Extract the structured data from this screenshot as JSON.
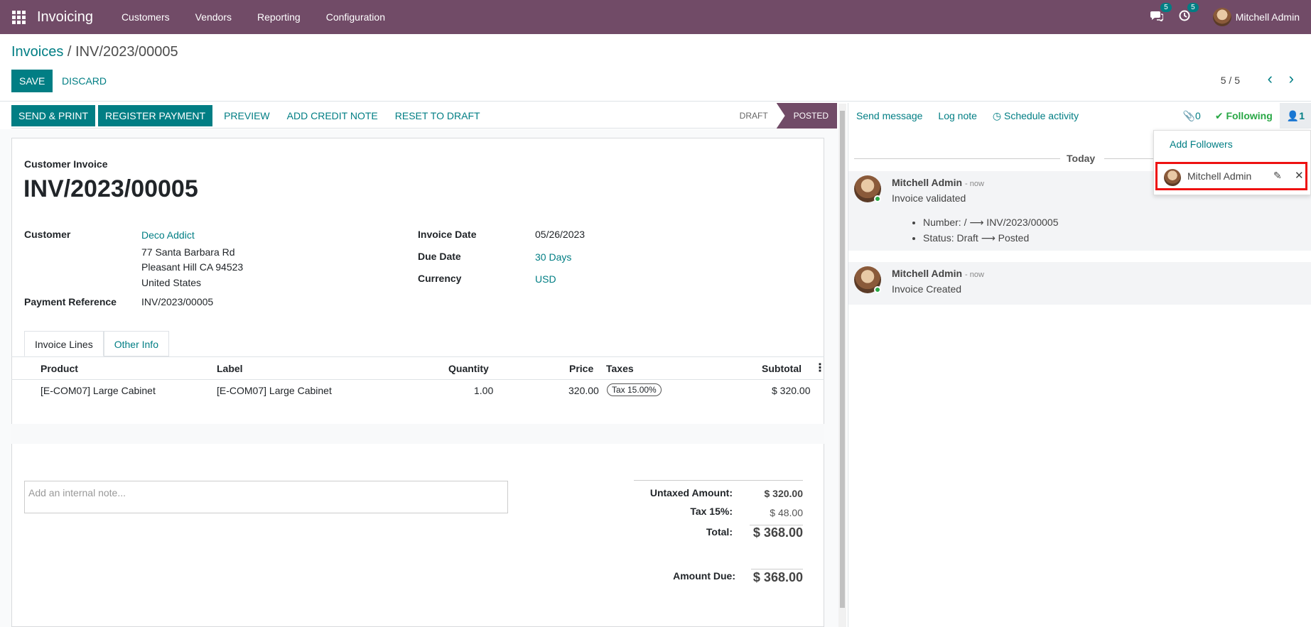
{
  "navbar": {
    "app_name": "Invoicing",
    "menu": [
      "Customers",
      "Vendors",
      "Reporting",
      "Configuration"
    ],
    "messages_badge": "5",
    "activities_badge": "5",
    "user_name": "Mitchell Admin",
    "bg_color": "#714b67"
  },
  "control_panel": {
    "breadcrumb_parent": "Invoices",
    "breadcrumb_sep": " / ",
    "breadcrumb_current": "INV/2023/00005",
    "save_label": "SAVE",
    "discard_label": "DISCARD",
    "pager": "5 / 5"
  },
  "statusbar": {
    "buttons_primary": [
      "SEND & PRINT",
      "REGISTER PAYMENT"
    ],
    "buttons_link": [
      "PREVIEW",
      "ADD CREDIT NOTE",
      "RESET TO DRAFT"
    ],
    "states": [
      "DRAFT",
      "POSTED"
    ],
    "active_state": "POSTED"
  },
  "invoice": {
    "type_label": "Customer Invoice",
    "number": "INV/2023/00005",
    "customer_label": "Customer",
    "customer_name": "Deco Addict",
    "address_line1": "77 Santa Barbara Rd",
    "address_line2": "Pleasant Hill CA 94523",
    "address_line3": "United States",
    "payment_ref_label": "Payment Reference",
    "payment_ref": "INV/2023/00005",
    "invoice_date_label": "Invoice Date",
    "invoice_date": "05/26/2023",
    "due_date_label": "Due Date",
    "due_date": "30 Days",
    "currency_label": "Currency",
    "currency": "USD"
  },
  "tabs": [
    "Invoice Lines",
    "Other Info"
  ],
  "lines": {
    "headers": [
      "Product",
      "Label",
      "Quantity",
      "Price",
      "Taxes",
      "Subtotal"
    ],
    "rows": [
      {
        "product": "[E-COM07] Large Cabinet",
        "label": "[E-COM07] Large Cabinet",
        "quantity": "1.00",
        "price": "320.00",
        "tax": "Tax 15.00%",
        "subtotal": "$ 320.00"
      }
    ]
  },
  "note_placeholder": "Add an internal note...",
  "totals": {
    "untaxed_label": "Untaxed Amount:",
    "untaxed": "$ 320.00",
    "tax_label": "Tax 15%:",
    "tax": "$ 48.00",
    "total_label": "Total:",
    "total": "$ 368.00",
    "amount_due_label": "Amount Due:",
    "amount_due": "$ 368.00"
  },
  "chatter": {
    "send_message": "Send message",
    "log_note": "Log note",
    "schedule_activity": "Schedule activity",
    "attachments_count": "0",
    "following": "Following",
    "followers_count": "1",
    "day_separator": "Today",
    "messages": [
      {
        "author": "Mitchell Admin",
        "time": "- now",
        "body": "Invoice validated",
        "changes": [
          "Number: / ⟶ INV/2023/00005",
          "Status: Draft ⟶ Posted"
        ]
      },
      {
        "author": "Mitchell Admin",
        "time": "- now",
        "body": "Invoice Created",
        "changes": []
      }
    ]
  },
  "followers_dropdown": {
    "add_followers": "Add Followers",
    "follower_name": "Mitchell Admin"
  }
}
